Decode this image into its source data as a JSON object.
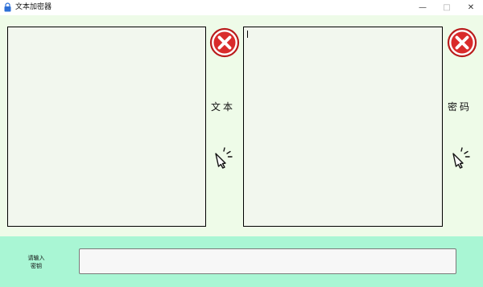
{
  "window": {
    "title": "文本加密器",
    "minimize_glyph": "—",
    "maximize_glyph": "□",
    "close_glyph": "✕"
  },
  "panels": {
    "text_label": "文本",
    "cipher_label": "密码",
    "text_value": "",
    "cipher_value": ""
  },
  "key": {
    "prompt_line1": "请输入",
    "prompt_line2": "密钥",
    "value": "",
    "placeholder": ""
  },
  "icons": {
    "app": "lock-icon",
    "clear": "red-x-circle-icon",
    "action": "cursor-click-icon"
  },
  "colors": {
    "panel_background": "#eefbe8",
    "textbox_background": "#f2f7ee",
    "bottom_background": "#a9f6d4",
    "clear_red": "#d92b2b"
  }
}
